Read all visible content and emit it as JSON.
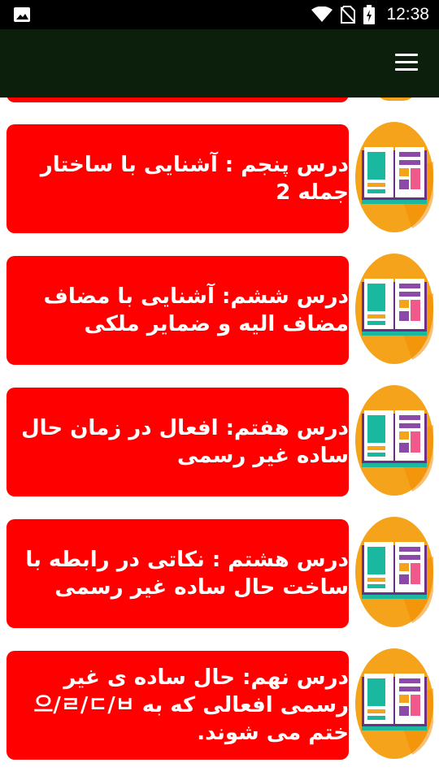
{
  "status_bar": {
    "time": "12:38",
    "icons": [
      "image-icon",
      "wifi-icon",
      "no-sim-icon",
      "battery-charging-icon"
    ]
  },
  "app_bar": {
    "menu_icon": "hamburger-menu-icon",
    "background": "#0c1f0c"
  },
  "colors": {
    "card": "#ff0000",
    "card_text": "#ffffff",
    "icon_circle": "#f5a31a"
  },
  "lessons": [
    {
      "title": "درس پنجم : آشنایی با ساختار جمله 2",
      "icon": "open-book-icon"
    },
    {
      "title": "درس ششم: آشنایی با مضاف مضاف الیه و ضمایر ملکی",
      "icon": "open-book-icon"
    },
    {
      "title": "درس هفتم: افعال در زمان حال ساده غیر رسمی",
      "icon": "open-book-icon"
    },
    {
      "title": "درس هشتم : نکاتی در رابطه با ساخت حال ساده غیر رسمی",
      "icon": "open-book-icon"
    },
    {
      "title": "درس نهم: حال ساده ی غیر رسمی افعالی که به 으/ㄹ/ㄷ/ㅂ ختم می شوند.",
      "icon": "open-book-icon"
    }
  ]
}
